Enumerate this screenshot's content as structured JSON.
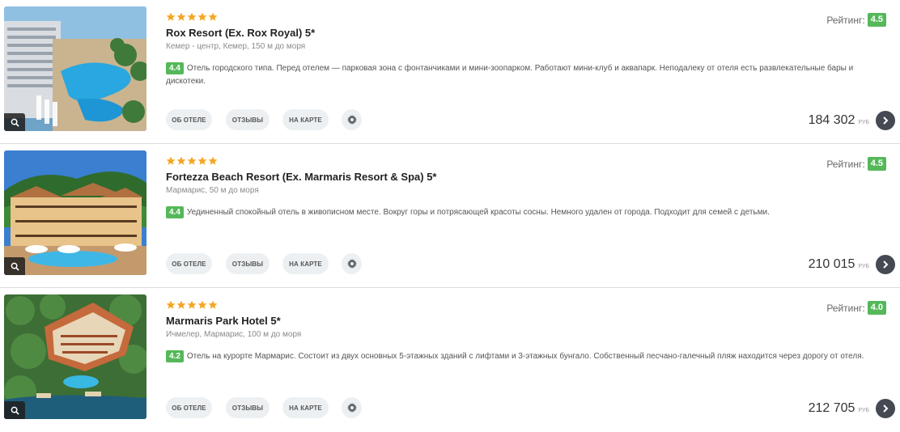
{
  "colors": {
    "accent_green": "#55b85a",
    "star": "#f5a623",
    "arrow_button": "#454a52",
    "pill": "#edf0f2"
  },
  "icons": {
    "star": "star-icon",
    "zoom": "magnifier-icon",
    "settings": "gear-icon",
    "next": "chevron-right-icon"
  },
  "hotels": [
    {
      "stars": 5,
      "title": "Rox Resort (Ex. Rox Royal) 5*",
      "location": "Кемер - центр, Кемер, 150 м до моря",
      "score": "4.4",
      "description": "Отель городского типа. Перед отелем — парковая зона с фонтанчиками и мини-зоопарком. Работают мини-клуб и аквапарк. Неподалеку от отеля есть развлекательные бары и дискотеки.",
      "rating_label": "Рейтинг:",
      "rating_value": "4.5",
      "buttons": {
        "about": "ОБ ОТЕЛЕ",
        "reviews": "ОТЗЫВЫ",
        "map": "НА КАРТЕ"
      },
      "price": "184 302",
      "currency": "РУБ"
    },
    {
      "stars": 5,
      "title": "Fortezza Beach Resort (Ex. Marmaris Resort & Spa) 5*",
      "location": "Мармарис, 50 м до моря",
      "score": "4.4",
      "description": "Уединенный спокойный отель в живописном месте. Вокруг горы и потрясающей красоты сосны. Немного удален от города. Подходит для семей с детьми.",
      "rating_label": "Рейтинг:",
      "rating_value": "4.5",
      "buttons": {
        "about": "ОБ ОТЕЛЕ",
        "reviews": "ОТЗЫВЫ",
        "map": "НА КАРТЕ"
      },
      "price": "210 015",
      "currency": "РУБ"
    },
    {
      "stars": 5,
      "title": "Marmaris Park Hotel 5*",
      "location": "Ичмелер, Мармарис, 100 м до моря",
      "score": "4.2",
      "description": "Отель на курорте Мармарис. Состоит из двух основных 5-этажных зданий с лифтами и 3-этажных бунгало. Собственный песчано-галечный пляж находится через дорогу от отеля.",
      "rating_label": "Рейтинг:",
      "rating_value": "4.0",
      "buttons": {
        "about": "ОБ ОТЕЛЕ",
        "reviews": "ОТЗЫВЫ",
        "map": "НА КАРТЕ"
      },
      "price": "212 705",
      "currency": "РУБ"
    }
  ]
}
